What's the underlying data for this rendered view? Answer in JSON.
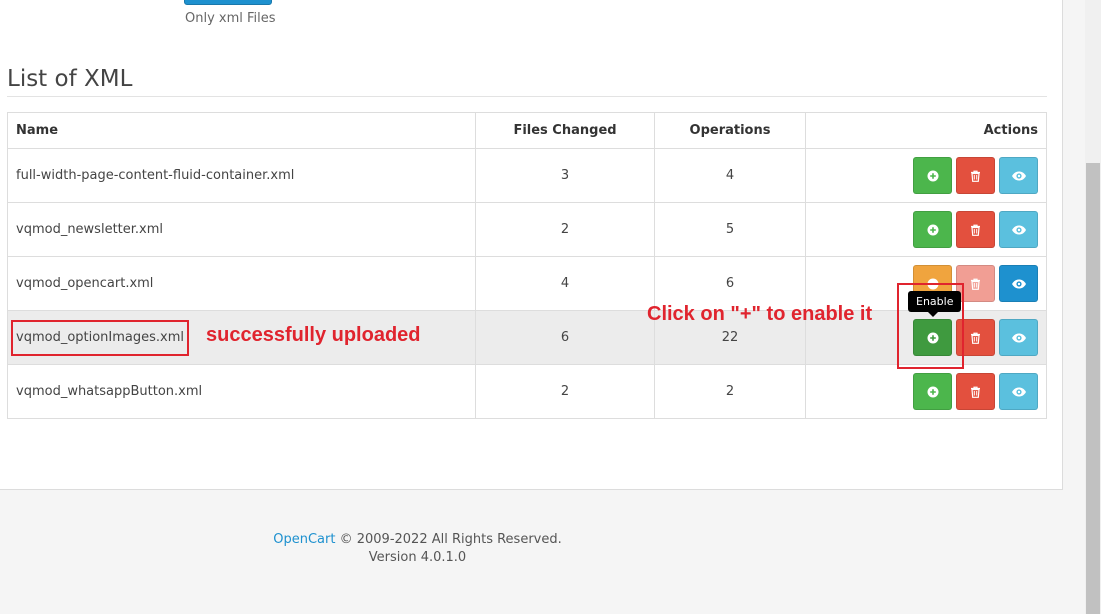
{
  "upload": {
    "hint": "Only xml Files"
  },
  "section": {
    "title": "List of XML"
  },
  "table": {
    "headers": {
      "name": "Name",
      "files_changed": "Files Changed",
      "operations": "Operations",
      "actions": "Actions"
    },
    "rows": [
      {
        "name": "full-width-page-content-fluid-container.xml",
        "files_changed": "3",
        "operations": "4"
      },
      {
        "name": "vqmod_newsletter.xml",
        "files_changed": "2",
        "operations": "5"
      },
      {
        "name": "vqmod_opencart.xml",
        "files_changed": "4",
        "operations": "6"
      },
      {
        "name": "vqmod_optionImages.xml",
        "files_changed": "6",
        "operations": "22"
      },
      {
        "name": "vqmod_whatsappButton.xml",
        "files_changed": "2",
        "operations": "2"
      }
    ]
  },
  "tooltip": {
    "label": "Enable"
  },
  "annotations": {
    "uploaded": "successfully uploaded",
    "instruction": "Click on \"+\" to enable it",
    "color": "#e0242e"
  },
  "footer": {
    "brand": "OpenCart",
    "copyright": " © 2009-2022 All Rights Reserved.",
    "version": "Version 4.0.1.0"
  },
  "colors": {
    "enable": "#4cb64c",
    "delete": "#e3503e",
    "view": "#5bc0de",
    "primary": "#1e91cf",
    "warning": "#f0a43e"
  },
  "icons": {
    "enable": "plus-circle-icon",
    "delete": "trash-icon",
    "view": "eye-icon",
    "disable": "minus-circle-icon"
  }
}
